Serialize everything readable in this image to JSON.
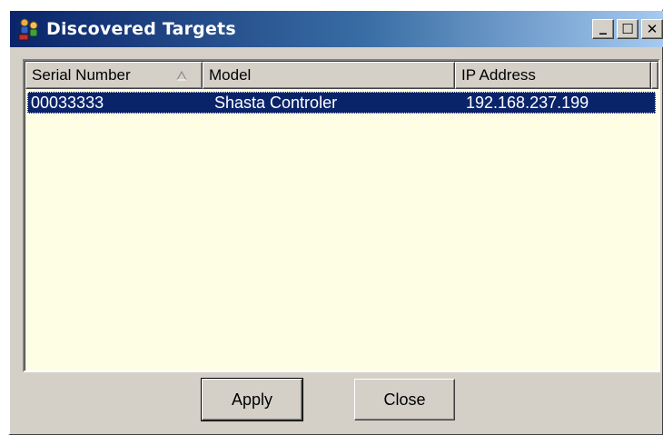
{
  "window": {
    "title": "Discovered Targets",
    "minimize_label": "_",
    "maximize_label": "☐",
    "close_label": "✕"
  },
  "list": {
    "columns": [
      {
        "label": "Serial Number",
        "sorted": "ascending"
      },
      {
        "label": "Model"
      },
      {
        "label": "IP Address"
      }
    ],
    "rows": [
      {
        "serial": "00033333",
        "model": "Shasta Controler",
        "ip": "192.168.237.199",
        "selected": true
      }
    ]
  },
  "buttons": {
    "apply_label": "Apply",
    "close_label": "Close"
  },
  "colors": {
    "titlebar_start": "#0a246a",
    "titlebar_end": "#a6caf0",
    "list_background": "#fefee4",
    "selection": "#0a246a",
    "face": "#d4d0c8"
  },
  "icons": {
    "title_icon": "network-targets-icon",
    "sort_icon": "sort-ascending-icon"
  }
}
